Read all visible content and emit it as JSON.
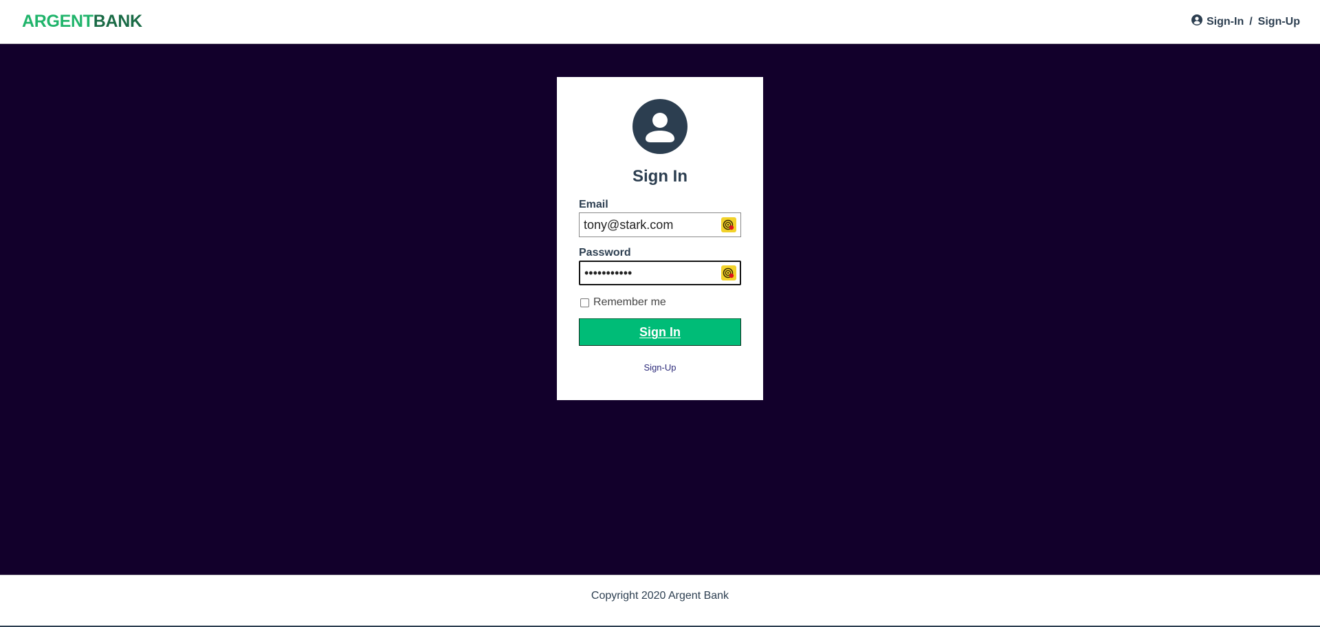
{
  "header": {
    "logo_part1": "ARGENT",
    "logo_part2": "BANK",
    "nav_signin": "Sign-In",
    "nav_separator": "/",
    "nav_signup": "Sign-Up"
  },
  "colors": {
    "brand_green": "#00bc77",
    "logo_dark_green": "#1a6b46",
    "background_dark": "#12002b",
    "text_dark": "#2c3e50"
  },
  "signin_form": {
    "title": "Sign In",
    "email_label": "Email",
    "email_value": "tony@stark.com",
    "password_label": "Password",
    "password_value": "•••••••••••",
    "remember_label": "Remember me",
    "remember_checked": false,
    "submit_label": "Sign In",
    "signup_link": "Sign-Up"
  },
  "icons": {
    "user_circle": "user-circle-icon",
    "avatar": "avatar-icon",
    "autofill": "password-manager-icon"
  },
  "footer": {
    "copyright": "Copyright 2020 Argent Bank"
  }
}
